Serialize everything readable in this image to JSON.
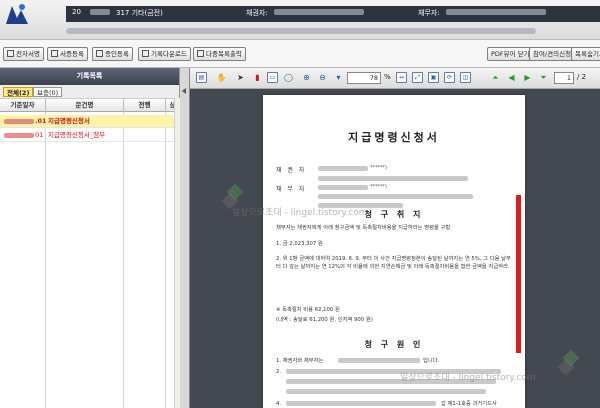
{
  "header": {
    "year_text": "20",
    "case_text": "317 기타(금전)",
    "creditor_label": "채권자:",
    "debtor_label": "채무자:"
  },
  "toolbar": {
    "buttons": [
      "전자서명",
      "서증등록",
      "증인등록",
      "기록다운로드",
      "다중목록출력"
    ],
    "pdf_btn": "PDF뷰어 닫기",
    "consult_btn": "참여/견의신청",
    "list_btn": "목록숨기기"
  },
  "left_panel": {
    "title": "기록목록",
    "tab_all": "전체(2)",
    "tab_supp": "보충(0)",
    "columns": [
      "기준일자",
      "문건명",
      "전행",
      "상"
    ],
    "rows": [
      {
        "date_suffix": ".01",
        "name": "지급명령신청서",
        "selected": true
      },
      {
        "date_suffix": "01",
        "name": "지급명령신청서_첨부",
        "selected": false
      }
    ]
  },
  "viewer": {
    "zoom": "78",
    "pct": "%",
    "page": "1",
    "total": "/ 2"
  },
  "document": {
    "title": "지급명령신청서",
    "creditor": "채   권   자",
    "debtor": "채   무   자",
    "stars1": "******)",
    "stars2": "******)",
    "section_claim": "청 구 취 지",
    "p1": "채무자는 채권자에게 아래 청구금액 및 독촉절차비용을 지급하라는 명령을 구함",
    "p2": "1. 금 2,023,307 원",
    "p3": "2. 위 1항 금액에 대하여 2019. 6. 9. 부터 이 사건 지급명령정본이 송달된 날까지는 연 5%, 그 다음 날부터 다 갚는 날까지는 연 12%의 각 비율에 의한 지연손해금 및 아래 독촉절차비용을 합한 금액을 지급하라.",
    "p4": "※ 독촉절차 비용 62,100 원",
    "p5": "(내역 : 송달료 61,200 원, 인지액 900 원)",
    "section_cause": "청 구 원 인",
    "p6": "1. 채권자와 채무자는",
    "p6b": "입니다.",
    "p7": "2.",
    "p8": "4.",
    "p8b": "갑 제1-1호증 과거기드사"
  },
  "watermark": "일상으로초대 - lingel.tistory.com",
  "watermark2": "일상으로초대 - lingel.tistory.com"
}
